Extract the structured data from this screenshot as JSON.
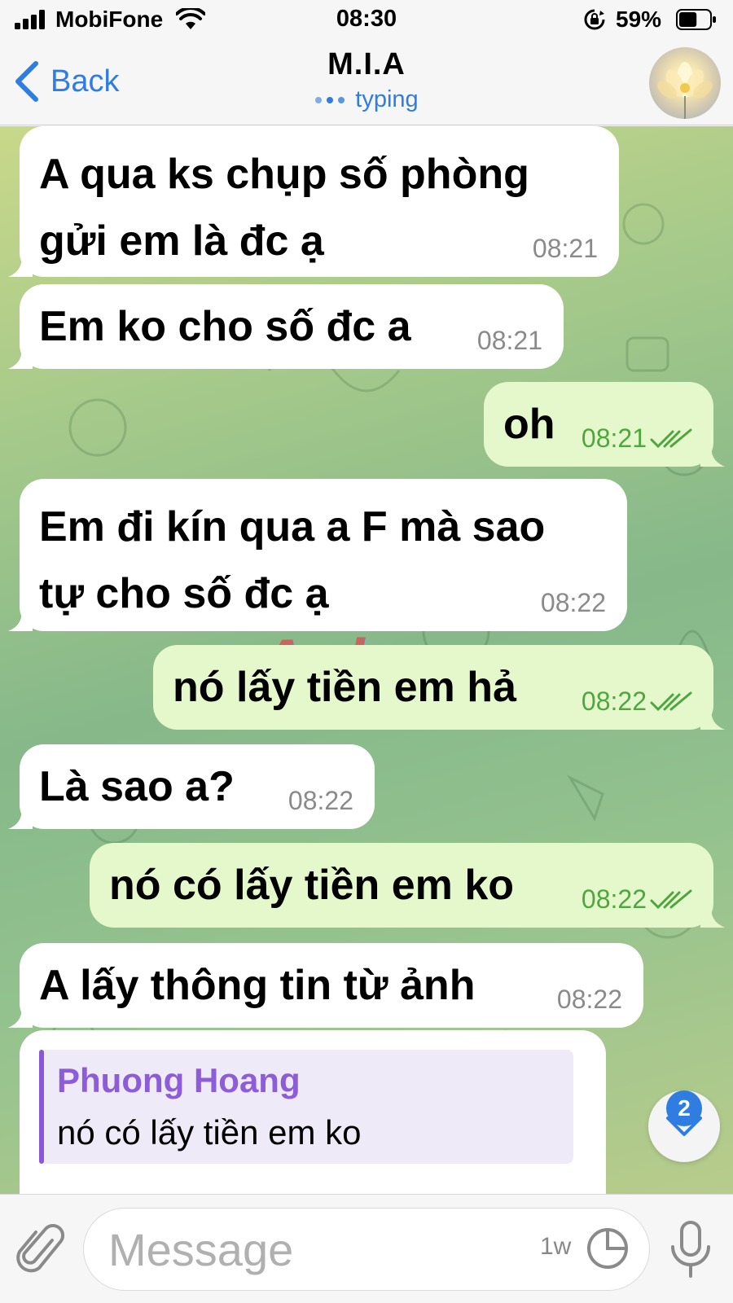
{
  "status_bar": {
    "carrier": "MobiFone",
    "time": "08:30",
    "battery_percent": "59%",
    "battery_level": 0.59,
    "icons": [
      "signal-icon",
      "wifi-icon",
      "rotation-lock-icon",
      "battery-icon"
    ]
  },
  "header": {
    "back_label": "Back",
    "title": "M.I.A",
    "status": "typing",
    "accent": "#2f7de1"
  },
  "messages": [
    {
      "direction": "in",
      "text": "A qua ks chụp số phòng\ngửi em là đc ạ",
      "time": "08:21"
    },
    {
      "direction": "in",
      "text": "Em ko cho số đc a",
      "time": "08:21"
    },
    {
      "direction": "out",
      "text": "oh",
      "time": "08:21"
    },
    {
      "direction": "in",
      "text": "Em đi kín qua a F mà sao\ntự cho số đc ạ",
      "time": "08:22"
    },
    {
      "direction": "out",
      "text": "nó lấy tiền em hả",
      "time": "08:22"
    },
    {
      "direction": "in",
      "text": "Là sao a?",
      "time": "08:22"
    },
    {
      "direction": "out",
      "text": "nó có lấy tiền em ko",
      "time": "08:22"
    },
    {
      "direction": "in",
      "text": "A lấy thông tin từ ảnh",
      "time": "08:22"
    }
  ],
  "reply": {
    "name": "Phuong Hoang",
    "quoted_text": "nó có lấy tiền em ko"
  },
  "watermark": "Aphang",
  "scroll_down": {
    "unread_count": "2"
  },
  "input": {
    "placeholder": "Message",
    "timer_label": "1w"
  },
  "colors": {
    "incoming_bubble": "#ffffff",
    "outgoing_bubble": "#e5f8cc",
    "outgoing_time": "#4fa63f",
    "reply_accent": "#8a57d8"
  }
}
